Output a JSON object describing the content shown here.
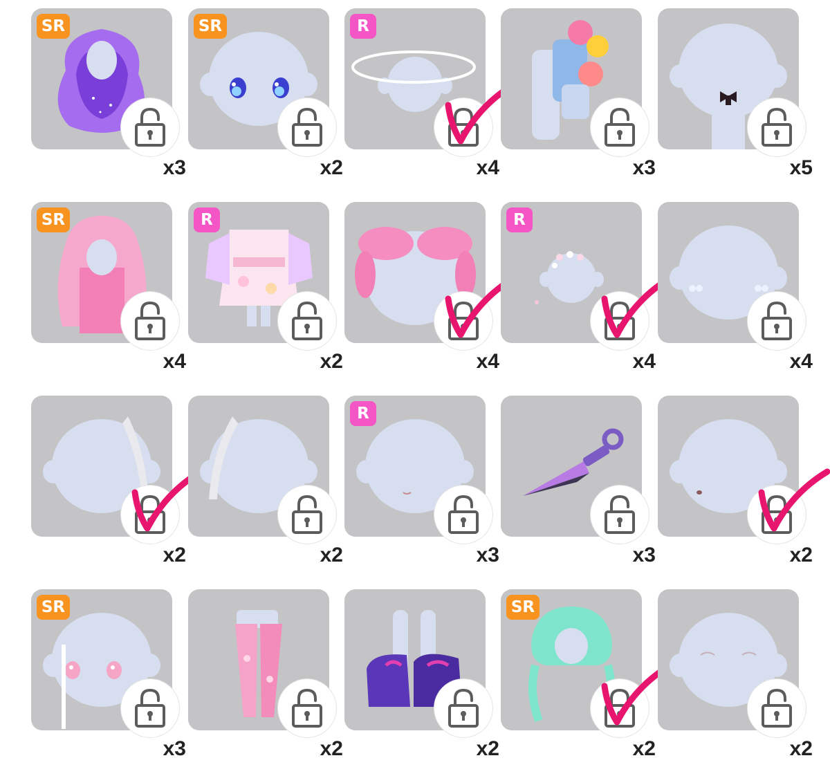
{
  "colors": {
    "card_bg": "#c4c4c6",
    "sr_badge": "#f7931e",
    "r_badge": "#f456c5",
    "check_mark": "#e8156f",
    "head": "#d6deef"
  },
  "items": [
    {
      "rarity": "SR",
      "count": "x3",
      "art": "purple-hair-icon",
      "checked": false
    },
    {
      "rarity": "SR",
      "count": "x2",
      "art": "blue-eyes-icon",
      "checked": false
    },
    {
      "rarity": "R",
      "count": "x4",
      "art": "halo-icon",
      "checked": true
    },
    {
      "rarity": "",
      "count": "x3",
      "art": "plushie-backpack-icon",
      "checked": false
    },
    {
      "rarity": "",
      "count": "x5",
      "art": "black-bow-icon",
      "checked": false
    },
    {
      "rarity": "SR",
      "count": "x4",
      "art": "pink-long-hair-icon",
      "checked": false
    },
    {
      "rarity": "R",
      "count": "x2",
      "art": "sakura-kimono-icon",
      "checked": false
    },
    {
      "rarity": "",
      "count": "x4",
      "art": "pink-hair-puffs-icon",
      "checked": true
    },
    {
      "rarity": "R",
      "count": "x4",
      "art": "sparkle-crown-icon",
      "checked": true
    },
    {
      "rarity": "",
      "count": "x4",
      "art": "cheek-sparkles-icon",
      "checked": false
    },
    {
      "rarity": "",
      "count": "x2",
      "art": "silver-hair-strand-right-icon",
      "checked": true
    },
    {
      "rarity": "",
      "count": "x2",
      "art": "silver-hair-strand-left-icon",
      "checked": false
    },
    {
      "rarity": "R",
      "count": "x3",
      "art": "small-mouth-icon",
      "checked": false
    },
    {
      "rarity": "",
      "count": "x3",
      "art": "kunai-icon",
      "checked": false
    },
    {
      "rarity": "",
      "count": "x2",
      "art": "tiny-mouth-icon",
      "checked": true
    },
    {
      "rarity": "SR",
      "count": "x3",
      "art": "pink-eyes-icon",
      "checked": false
    },
    {
      "rarity": "",
      "count": "x2",
      "art": "pink-leggings-icon",
      "checked": false
    },
    {
      "rarity": "",
      "count": "x2",
      "art": "purple-sneakers-icon",
      "checked": false
    },
    {
      "rarity": "SR",
      "count": "x2",
      "art": "mint-braid-hair-icon",
      "checked": true
    },
    {
      "rarity": "",
      "count": "x2",
      "art": "closed-eyes-icon",
      "checked": false
    }
  ]
}
